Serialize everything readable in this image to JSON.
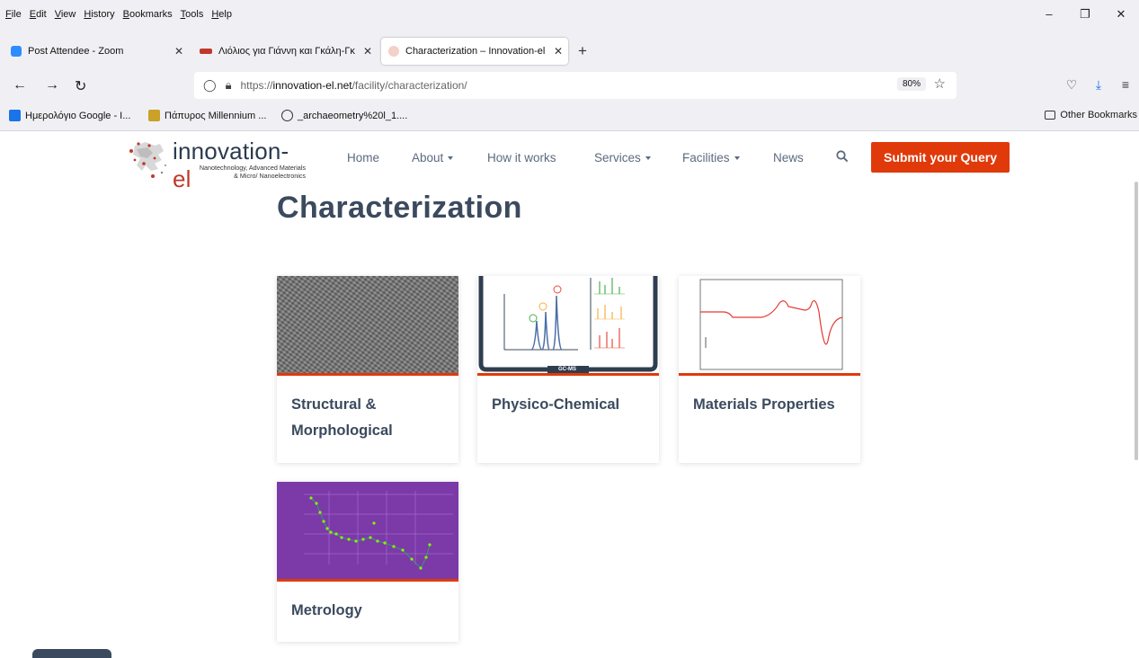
{
  "menu": [
    "File",
    "Edit",
    "View",
    "History",
    "Bookmarks",
    "Tools",
    "Help"
  ],
  "window_controls": {
    "minimize": "–",
    "restore": "❐",
    "close": "✕"
  },
  "tabs": [
    {
      "title": "Post Attendee - Zoom",
      "icon": "zoom-icon"
    },
    {
      "title": "Λιόλιος για Γιάννη και Γκάλη-Γκ",
      "icon": "video-icon"
    },
    {
      "title": "Characterization – Innovation-el",
      "icon": "site-icon",
      "active": true
    }
  ],
  "new_tab_label": "+",
  "tab_close_label": "✕",
  "url": {
    "prefix": "https://",
    "host": "innovation-el.net",
    "path": "/facility/characterization/"
  },
  "zoom_level": "80%",
  "bookmarks": [
    {
      "label": "Ημερολόγιο Google - I...",
      "icon": "calendar-icon"
    },
    {
      "label": "Πάπυρος Millennium ...",
      "icon": "papyrus-icon"
    },
    {
      "label": "_archaeometry%20l_1....",
      "icon": "globe-icon"
    }
  ],
  "other_bookmarks": "Other Bookmarks",
  "site": {
    "logo_name": "innovation-",
    "logo_name_accent": "el",
    "logo_tagline_1": "Nanotechnology, Advanced Materials",
    "logo_tagline_2": "& Micro/ Nanoelectronics",
    "nav": [
      {
        "label": "Home",
        "dropdown": false
      },
      {
        "label": "About",
        "dropdown": true
      },
      {
        "label": "How it works",
        "dropdown": false
      },
      {
        "label": "Services",
        "dropdown": true
      },
      {
        "label": "Facilities",
        "dropdown": true
      },
      {
        "label": "News",
        "dropdown": false
      }
    ],
    "cta": "Submit your Query",
    "title": "Characterization",
    "cards": [
      {
        "caption_1": "Structural &",
        "caption_2": "Morphological",
        "image": "tem-lattice-image"
      },
      {
        "caption_1": "Physico-Chemical",
        "caption_2": "",
        "image": "gc-ms-chart-image"
      },
      {
        "caption_1": "Materials Properties",
        "caption_2": "",
        "image": "dsc-curve-image"
      },
      {
        "caption_1": "Metrology",
        "caption_2": "",
        "image": "oc-plot-image"
      }
    ],
    "gcms_label": "GC-MS",
    "accent_color": "#e03a0a",
    "text_color": "#3b4a5e"
  }
}
